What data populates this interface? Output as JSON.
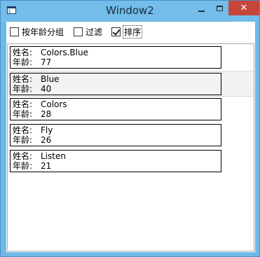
{
  "window": {
    "title": "Window2",
    "controls": {
      "minimize": "—",
      "maximize": "☐",
      "close": "✕"
    }
  },
  "toolbar": {
    "group_by_age": {
      "label": "按年龄分组",
      "checked": false
    },
    "filter": {
      "label": "过滤",
      "checked": false
    },
    "sort": {
      "label": "排序",
      "checked": true
    }
  },
  "labels": {
    "name": "姓名:",
    "age": "年龄:"
  },
  "people": [
    {
      "name": "Colors.Blue",
      "age": "77"
    },
    {
      "name": "Blue",
      "age": "40"
    },
    {
      "name": "Colors",
      "age": "28"
    },
    {
      "name": "Fly",
      "age": "26"
    },
    {
      "name": "Listen",
      "age": "21"
    }
  ],
  "highlighted_row_index": 1,
  "colors": {
    "title_bar": "#72bdea",
    "close_button": "#c7463a",
    "list_border": "#abadb3",
    "row_highlight": "#f2f2f2"
  }
}
